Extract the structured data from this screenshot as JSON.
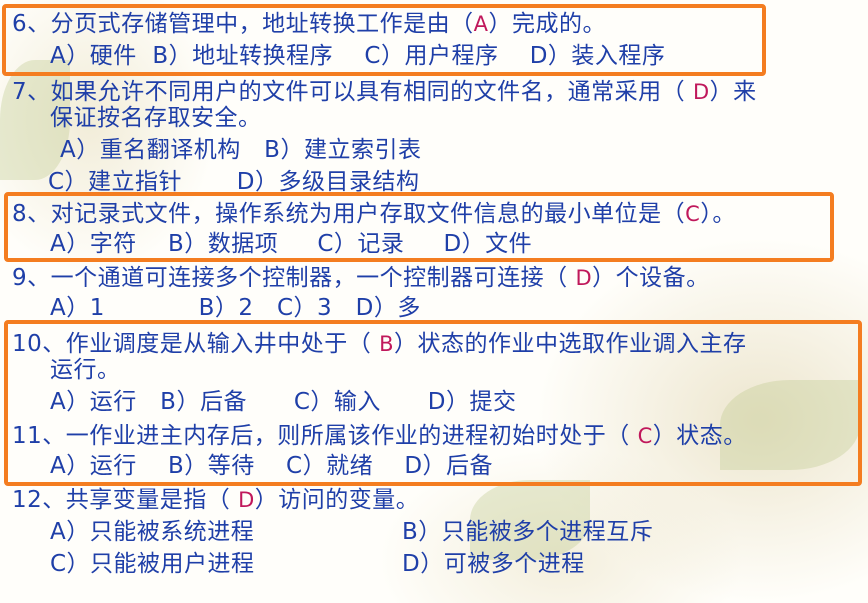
{
  "q6": {
    "prefix": "6、分页式存储管理中，地址转换工作是由（",
    "answer": "A",
    "suffix": "）完成的。",
    "opts": [
      "A）硬件",
      "B）地址转换程序",
      "C）用户程序",
      "D）装入程序"
    ]
  },
  "q7": {
    "prefix": "7、如果允许不同用户的文件可以具有相同的文件名，通常采用（ ",
    "answer": "D",
    "suffix": "）来",
    "line2": "保证按名存取安全。",
    "opts": [
      "A）重名翻译机构",
      "B）建立索引表",
      "C）建立指针",
      "D）多级目录结构"
    ]
  },
  "q8": {
    "prefix": "8、对记录式文件，操作系统为用户存取文件信息的最小单位是（",
    "answer": "C",
    "suffix": "）。",
    "opts": [
      "A）字符",
      "B）数据项",
      "C）记录",
      "D）文件"
    ]
  },
  "q9": {
    "prefix": "9、一个通道可连接多个控制器，一个控制器可连接（ ",
    "answer": "D",
    "suffix": "）个设备。",
    "opts": [
      "A）1",
      "B）2",
      "C）3",
      "D）多"
    ]
  },
  "q10": {
    "prefix": "10、作业调度是从输入井中处于（ ",
    "answer": "B",
    "suffix": "）状态的作业中选取作业调入主存",
    "line2": "运行。",
    "opts": [
      "A）运行",
      "B）后备",
      "C）输入",
      "D）提交"
    ]
  },
  "q11": {
    "prefix": "11、一作业进主内存后，则所属该作业的进程初始时处于（ ",
    "answer": "C",
    "suffix": "）状态。",
    "opts": [
      "A）运行",
      "B）等待",
      "C）就绪",
      "D）后备"
    ]
  },
  "q12": {
    "prefix": "12、共享变量是指（ ",
    "answer": "D",
    "suffix": "）访问的变量。",
    "opts": [
      "A）只能被系统进程",
      "B）只能被多个进程互斥",
      "C）只能被用户进程",
      "D）可被多个进程"
    ]
  },
  "colors": {
    "text": "#1f3fa8",
    "answer": "#c0185b",
    "highlight": "#f47d20"
  }
}
